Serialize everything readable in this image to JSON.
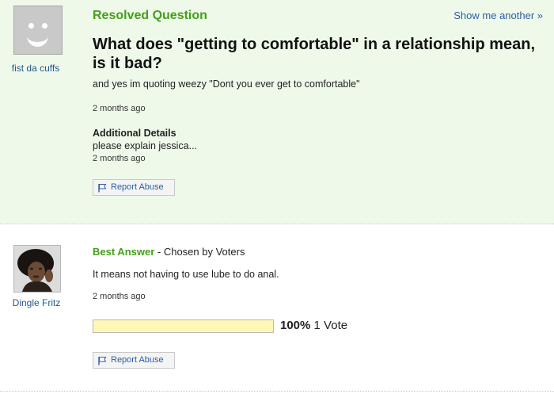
{
  "question": {
    "asker_name": "fist da cuffs",
    "status": "Resolved Question",
    "show_another": "Show me another »",
    "title": "What does \"getting to comfortable\" in a relationship mean, is it bad?",
    "body": "and yes im quoting weezy \"Dont you ever get to comfortable\"",
    "time": "2 months ago",
    "details_heading": "Additional Details",
    "details_text": "please explain jessica...",
    "details_time": "2 months ago",
    "report_label": "Report Abuse"
  },
  "answer": {
    "answerer_name": "Dingle Fritz",
    "best_answer_label": "Best Answer",
    "chosen_by": " - Chosen by Voters",
    "text": "It means not having to use lube to do anal.",
    "time": "2 months ago",
    "vote_percent": "100%",
    "vote_fraction": 1.0,
    "vote_count": "1 Vote",
    "report_label": "Report Abuse"
  },
  "icons": {
    "report": "flag-icon",
    "asker_avatar": "default-avatar-icon"
  },
  "colors": {
    "question_bg": "#eef9ea",
    "accent_green": "#43a019",
    "link_blue": "#2b5ea3",
    "vote_bar": "#fffcd0"
  }
}
